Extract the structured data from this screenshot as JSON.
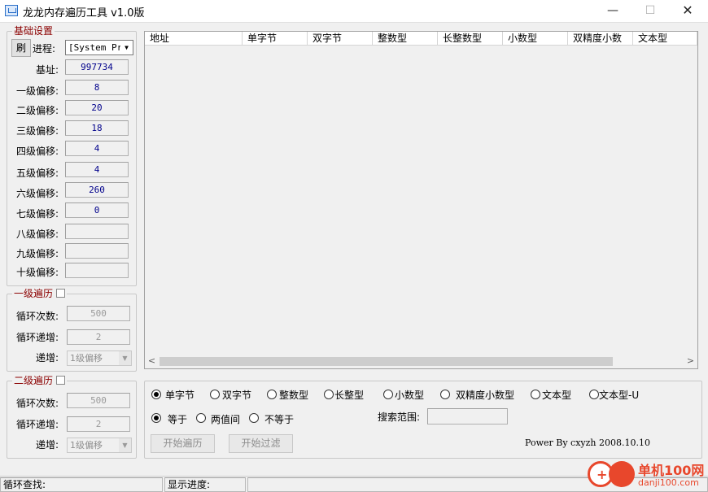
{
  "window": {
    "title": "龙龙内存遍历工具 v1.0版",
    "min_glyph": "—",
    "max_glyph": "☐",
    "close_glyph": "✕"
  },
  "basic": {
    "title": "基础设置",
    "refresh_label": "刷",
    "process_label": "进程:",
    "process_value": "[System Pr",
    "base_label": "基址:",
    "base_value": "997734",
    "offsets": [
      {
        "label": "一级偏移:",
        "value": "8"
      },
      {
        "label": "二级偏移:",
        "value": "20"
      },
      {
        "label": "三级偏移:",
        "value": "18"
      },
      {
        "label": "四级偏移:",
        "value": "4"
      },
      {
        "label": "五级偏移:",
        "value": "4"
      },
      {
        "label": "六级偏移:",
        "value": "260"
      },
      {
        "label": "七级偏移:",
        "value": "0"
      },
      {
        "label": "八级偏移:",
        "value": ""
      },
      {
        "label": "九级偏移:",
        "value": ""
      },
      {
        "label": "十级偏移:",
        "value": ""
      }
    ]
  },
  "loop1": {
    "title": "一级遍历",
    "count_label": "循环次数:",
    "count_value": "500",
    "step_label": "循环递增:",
    "step_value": "2",
    "inc_label": "递增:",
    "inc_value": "1级偏移"
  },
  "loop2": {
    "title": "二级遍历",
    "count_label": "循环次数:",
    "count_value": "500",
    "step_label": "循环递增:",
    "step_value": "2",
    "inc_label": "递增:",
    "inc_value": "1级偏移"
  },
  "list": {
    "columns": [
      "地址",
      "单字节",
      "双字节",
      "整数型",
      "长整数型",
      "小数型",
      "双精度小数",
      "文本型"
    ],
    "scroll_left": "<",
    "scroll_right": ">"
  },
  "search": {
    "types": [
      "单字节",
      "双字节",
      "整数型",
      "长整型",
      "小数型",
      "双精度小数型",
      "文本型",
      "文本型-U"
    ],
    "selected_type": 0,
    "compare": [
      "等于",
      "两值间",
      "不等于"
    ],
    "selected_compare": 0,
    "range_label": "搜索范围:",
    "range_value": "",
    "start_button": "开始遍历",
    "filter_button": "开始过滤",
    "power_text": "Power By cxyzh 2008.10.10"
  },
  "status": {
    "loop_label": "循环查找:",
    "progress_label": "显示进度:"
  },
  "watermark": {
    "cn": "单机100网",
    "en": "danji100.com"
  },
  "colors": {
    "group_title": "#8b0000",
    "value_text": "#00008b",
    "watermark": "#e8472c"
  }
}
